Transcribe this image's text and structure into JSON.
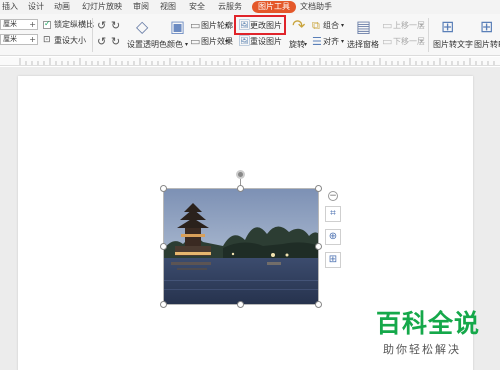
{
  "tabs": [
    "插入",
    "设计",
    "动画",
    "幻灯片放映",
    "审阅",
    "视图",
    "安全",
    "云服务",
    "图片工具",
    "文档助手"
  ],
  "active_tab": "图片工具",
  "accent_color": "#e4582a",
  "highlight_color": "#e0242a",
  "ribbon": {
    "size": {
      "height_value": "厘米",
      "width_value": "厘米",
      "lock_ratio_label": "锁定纵横比",
      "lock_ratio_checked": true,
      "reset_size_label": "重设大小"
    },
    "transparency_label": "设置透明色",
    "color_label": "颜色",
    "picture_outline_label": "图片轮廓",
    "picture_effect_label": "图片效果",
    "change_picture_label": "更改图片",
    "reset_picture_label": "重设图片",
    "rotate_label": "旋转",
    "group_label": "组合",
    "align_label": "对齐",
    "selection_pane_label": "选择窗格",
    "bring_forward_label": "上移一层",
    "send_backward_label": "下移一层",
    "pic_to_text_label": "图片转文字",
    "pic_to_pdf_label": "图片转PD"
  },
  "watermark": {
    "title": "百科全说",
    "subtitle": "助你轻松解决"
  }
}
